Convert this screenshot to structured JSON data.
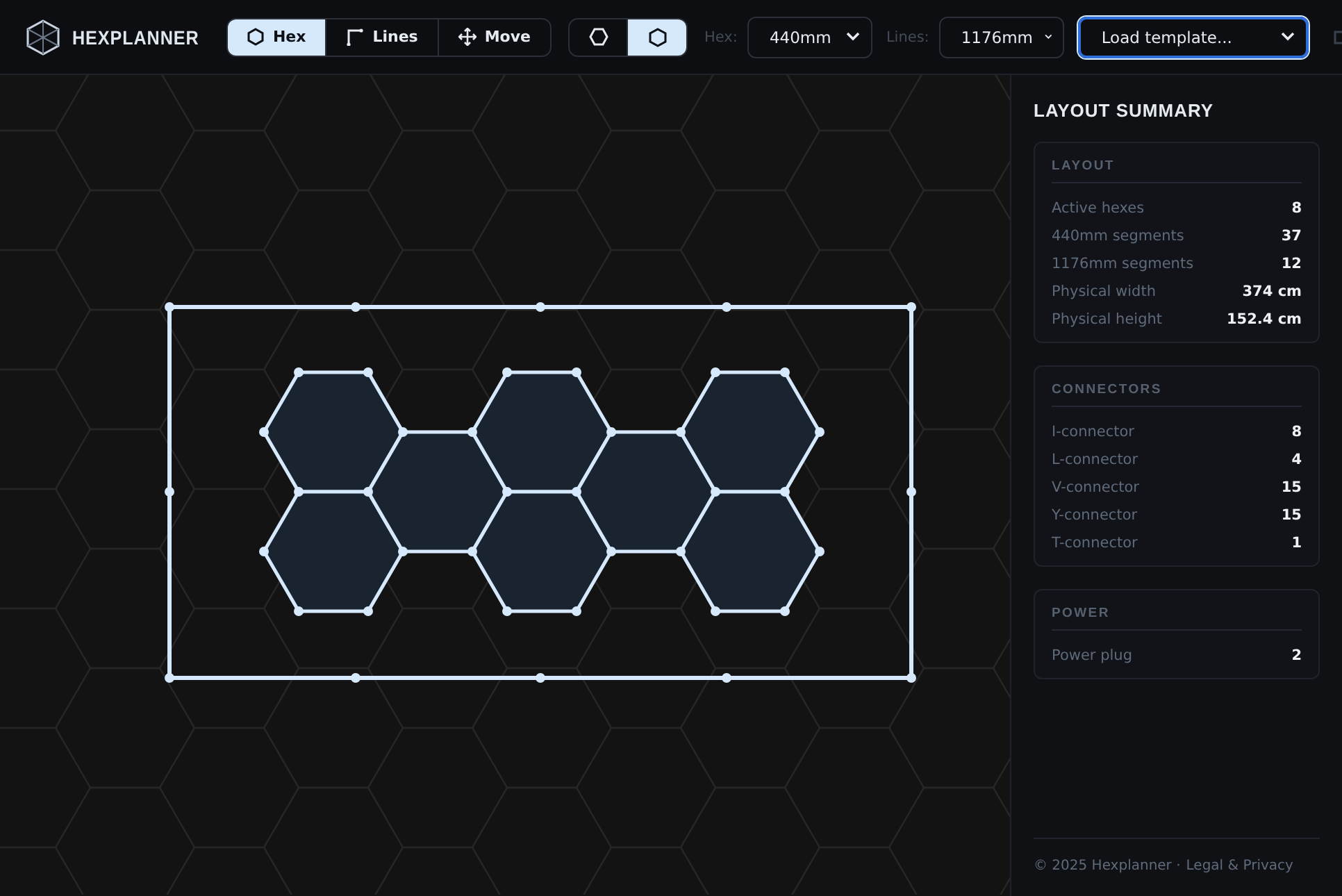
{
  "app": {
    "title": "HEXPLANNER"
  },
  "modes": [
    {
      "label": "Hex",
      "kind": "hex",
      "selected": true
    },
    {
      "label": "Lines",
      "kind": "corner",
      "selected": false
    },
    {
      "label": "Move",
      "kind": "move",
      "selected": false
    }
  ],
  "orientations": [
    {
      "kind": "flat",
      "selected": false
    },
    {
      "kind": "pointy",
      "selected": true
    }
  ],
  "selects": [
    {
      "label": "Hex:",
      "value": "440mm",
      "focused": false
    },
    {
      "label": "Lines:",
      "value": "1176mm",
      "focused": false
    },
    {
      "value": "Load template...",
      "focused": true
    }
  ],
  "summary": {
    "title": "LAYOUT SUMMARY",
    "sections": [
      {
        "title": "LAYOUT",
        "rows": [
          {
            "label": "Active hexes",
            "value": "8"
          },
          {
            "label": "440mm segments",
            "value": "37"
          },
          {
            "label": "1176mm segments",
            "value": "12"
          },
          {
            "label": "Physical width",
            "value": "374 cm"
          },
          {
            "label": "Physical height",
            "value": "152.4 cm"
          }
        ]
      },
      {
        "title": "CONNECTORS",
        "rows": [
          {
            "label": "I-connector",
            "value": "8"
          },
          {
            "label": "L-connector",
            "value": "4"
          },
          {
            "label": "V-connector",
            "value": "15"
          },
          {
            "label": "Y-connector",
            "value": "15"
          },
          {
            "label": "T-connector",
            "value": "1"
          }
        ]
      },
      {
        "title": "POWER",
        "rows": [
          {
            "label": "Power plug",
            "value": "2"
          }
        ]
      }
    ]
  },
  "footer": {
    "text": "© 2025 Hexplanner ·",
    "link": "Legal & Privacy"
  }
}
